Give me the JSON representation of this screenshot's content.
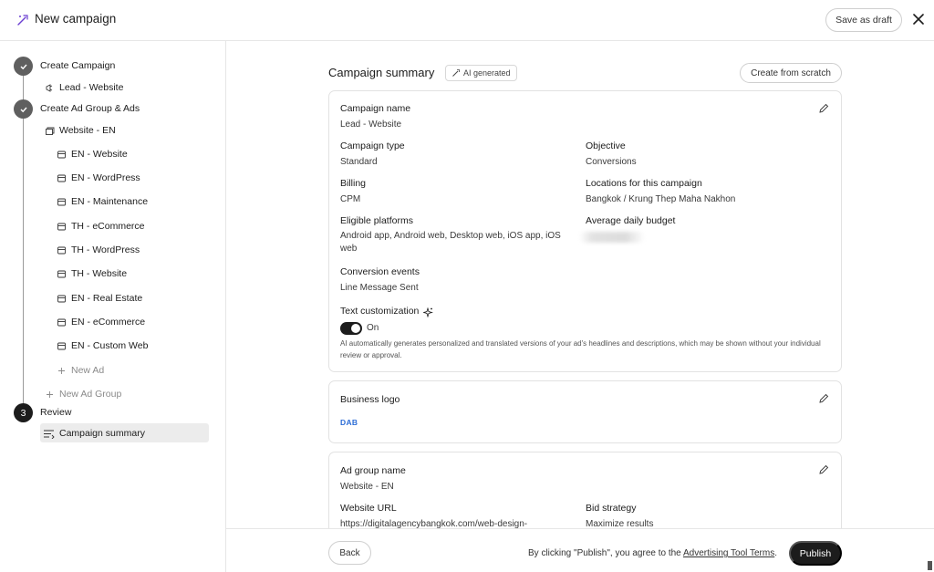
{
  "header": {
    "title": "New campaign",
    "save_draft": "Save as draft"
  },
  "sidebar": {
    "step1": {
      "label": "Create Campaign",
      "child": "Lead - Website"
    },
    "step2": {
      "label": "Create Ad Group & Ads",
      "group": "Website - EN",
      "ads": [
        "EN - Website",
        "EN - WordPress",
        "EN - Maintenance",
        "TH - eCommerce",
        "TH - WordPress",
        "TH - Website",
        "EN - Real Estate",
        "EN - eCommerce",
        "EN - Custom Web"
      ],
      "new_ad": "New Ad",
      "new_ad_group": "New Ad Group"
    },
    "step3": {
      "number": "3",
      "label": "Review",
      "child": "Campaign summary"
    }
  },
  "summary": {
    "title": "Campaign summary",
    "ai_badge": "AI generated",
    "create_scratch": "Create from scratch"
  },
  "campaign_card": {
    "campaign_name_label": "Campaign name",
    "campaign_name": "Lead - Website",
    "campaign_type_label": "Campaign type",
    "campaign_type": "Standard",
    "objective_label": "Objective",
    "objective": "Conversions",
    "billing_label": "Billing",
    "billing": "CPM",
    "locations_label": "Locations for this campaign",
    "locations": "Bangkok / Krung Thep Maha Nakhon",
    "platforms_label": "Eligible platforms",
    "platforms": "Android app, Android web, Desktop web, iOS app, iOS web",
    "budget_label": "Average daily budget",
    "conversion_label": "Conversion events",
    "conversion": "Line Message Sent",
    "text_custom_label": "Text customization",
    "toggle_state": "On",
    "text_custom_note": "AI automatically generates personalized and translated versions of your ad's headlines and descriptions, which may be shown without your individual review or approval."
  },
  "logo_card": {
    "label": "Business logo",
    "logo_text": "DAB"
  },
  "adgroup_card": {
    "name_label": "Ad group name",
    "name": "Website - EN",
    "url_label": "Website URL",
    "url": "https://digitalagencybangkok.com/web-design-",
    "bid_label": "Bid strategy",
    "bid": "Maximize results"
  },
  "footer": {
    "back": "Back",
    "terms_prefix": "By clicking \"Publish\", you agree to the",
    "terms_link": "Advertising Tool Terms",
    "terms_suffix": ".",
    "publish": "Publish"
  },
  "colors": {
    "accent": "#1c1c1c",
    "muted": "#8a8a8a",
    "border": "#e2e2e2"
  }
}
